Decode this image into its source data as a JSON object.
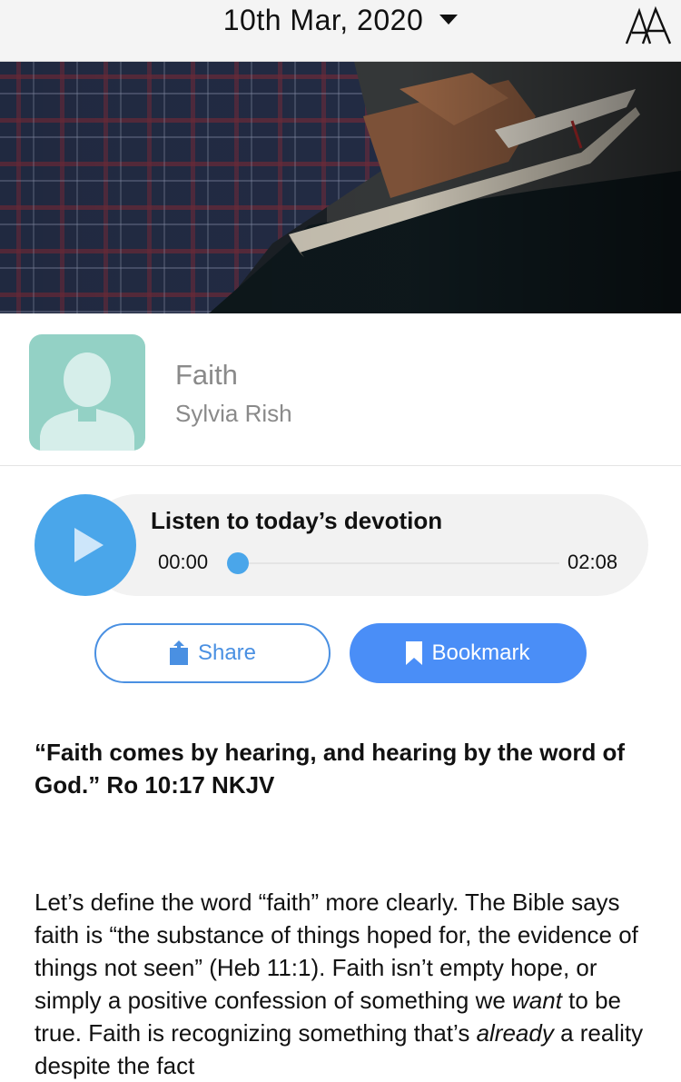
{
  "header": {
    "date": "10th Mar, 2020",
    "date_icon": "caret-down-icon",
    "font_size_icon": "text-size-icon"
  },
  "devotion": {
    "title": "Faith",
    "author": "Sylvia Rish",
    "avatar_icon": "person-silhouette-icon"
  },
  "player": {
    "label": "Listen to today’s devotion",
    "current_time": "00:00",
    "total_time": "02:08",
    "progress": 0,
    "play_icon": "play-icon"
  },
  "actions": {
    "share_label": "Share",
    "share_icon": "share-icon",
    "bookmark_label": "Bookmark",
    "bookmark_icon": "bookmark-icon"
  },
  "content": {
    "verse": "“Faith comes by hearing, and hearing by the word of God.” Ro 10:17 NKJV",
    "body_1": "Let’s define the word “faith” more clearly. The Bible says faith is “the substance of things hoped for, the evidence of things not seen” (Heb 11:1). Faith isn’t empty hope, or simply a positive confession of something we ",
    "body_em1": "want",
    "body_2": " to be true. Faith is recognizing something that’s ",
    "body_em2": "already",
    "body_3": " a reality despite the fact"
  },
  "colors": {
    "accent": "#4a8ef7",
    "play": "#4aa6ea",
    "avatar_bg": "#93d1c5"
  }
}
